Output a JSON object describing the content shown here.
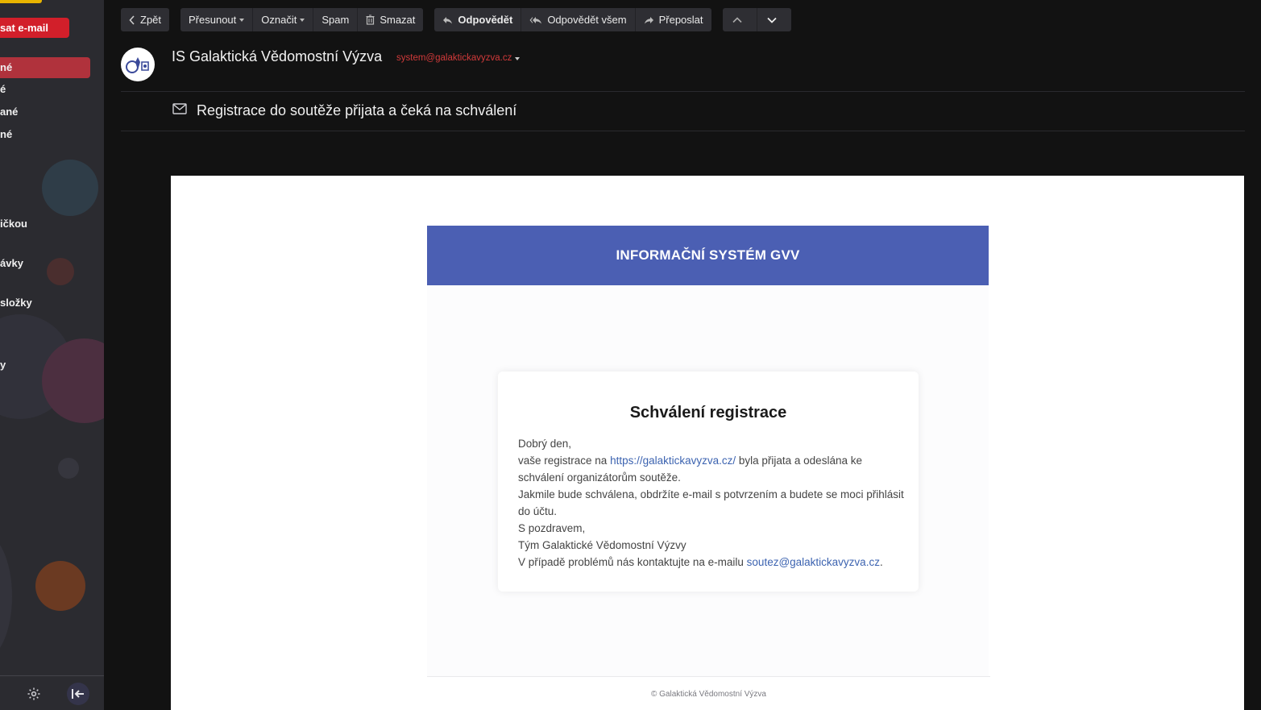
{
  "sidebar": {
    "compose_label": "sat e-mail",
    "items": [
      {
        "label": "né",
        "active": true
      },
      {
        "label": "é",
        "active": false
      },
      {
        "label": "ané",
        "active": false
      },
      {
        "label": "né",
        "active": false
      },
      {
        "label": "ičkou",
        "active": false
      },
      {
        "label": "ávky",
        "active": false
      },
      {
        "label": "složky",
        "active": false
      },
      {
        "label": "y",
        "active": false
      }
    ],
    "settings_icon": "gear-icon",
    "collapse_icon": "collapse-left-icon"
  },
  "toolbar": {
    "back_label": "Zpět",
    "move_label": "Přesunout",
    "mark_label": "Označit",
    "spam_label": "Spam",
    "delete_label": "Smazat",
    "reply_label": "Odpovědět",
    "reply_all_label": "Odpovědět všem",
    "forward_label": "Přeposlat"
  },
  "message": {
    "sender_name": "IS Galaktická Vědomostní Výzva",
    "sender_email": "system@galaktickavyzva.cz",
    "subject": "Registrace do soutěže přijata a čeká na schválení"
  },
  "email": {
    "banner": "INFORMAČNÍ SYSTÉM GVV",
    "title": "Schválení registrace",
    "greeting": "Dobrý den,",
    "line1_pre": "vaše registrace na ",
    "line1_link": "https://galaktickavyzva.cz/",
    "line1_post": " byla přijata a odeslána ke schválení organizátorům soutěže.",
    "line2": "Jakmile bude schválena, obdržíte e-mail s potvrzením a budete se moci přihlásit do účtu.",
    "sign1": "S pozdravem,",
    "sign2": "Tým Galaktické Vědomostní Výzvy",
    "contact_pre": "V případě problémů nás kontaktujte na e-mailu ",
    "contact_link": "soutez@galaktickavyzva.cz",
    "contact_post": ".",
    "footer": "© Galaktická Vědomostní Výzva"
  },
  "colors": {
    "accent_red": "#d21f2a",
    "banner_blue": "#4b5fb3",
    "link_blue": "#3c63b0",
    "sender_email_red": "#d23a3a"
  }
}
